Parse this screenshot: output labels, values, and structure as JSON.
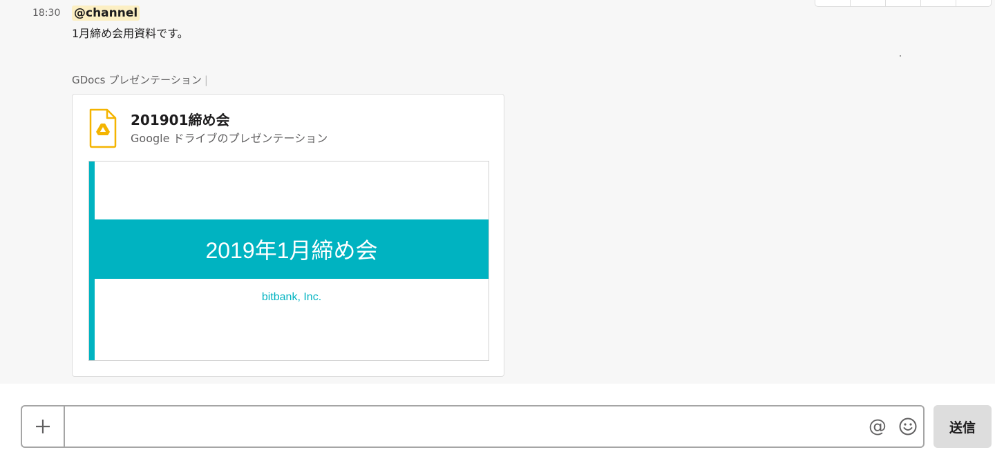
{
  "message": {
    "timestamp": "18:30",
    "mention": "@channel",
    "text": "1月締め会用資料です。"
  },
  "attachment": {
    "source_label": "GDocs プレゼンテーション",
    "source_divider": "|",
    "file": {
      "icon": "google-drive-slides-icon",
      "title": "201901締め会",
      "subtitle": "Google ドライブのプレゼンテーション"
    },
    "slide_preview": {
      "title": "2019年1月締め会",
      "subtitle": "bitbank, Inc."
    }
  },
  "composer": {
    "value": "",
    "placeholder": "",
    "plus_icon": "plus-icon",
    "at_icon": "@",
    "emoji_icon": "smiley-face-icon",
    "send_label": "送信"
  },
  "colors": {
    "slide_accent": "#00b3c1",
    "drive_icon": "#f4b400",
    "mention_highlight": "#fcefc3",
    "send_button_bg": "#dddddd"
  }
}
